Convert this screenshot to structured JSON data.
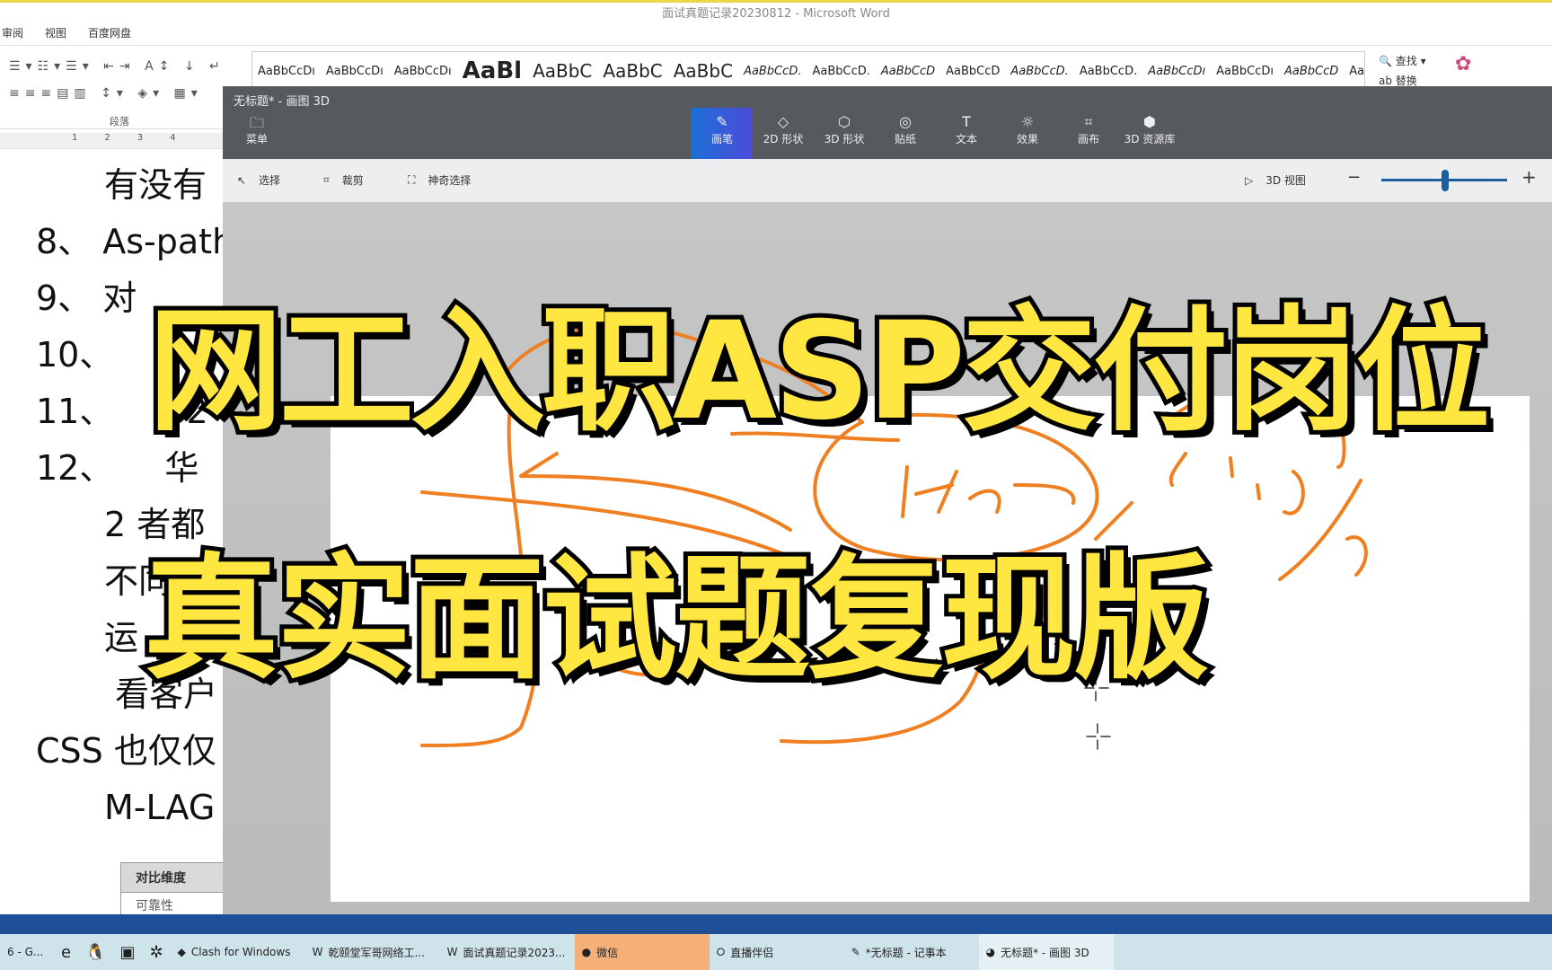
{
  "word": {
    "title": "面试真题记录20230812 - Microsoft Word",
    "tabs": [
      "审阅",
      "视图",
      "百度网盘"
    ],
    "paragraph_group": "段落",
    "styles": [
      "AaBbCcDı",
      "AaBbCcDı",
      "AaBbCcDı",
      "AaBl",
      "AaBbC",
      "AaBbC",
      "AaBbC",
      "AaBbCcD.",
      "AaBbCcD.",
      "AaBbCcD",
      "AaBbCcD",
      "AaBbCcD.",
      "AaBbCcD.",
      "AaBbCcDı",
      "AaBbCcDı",
      "AaBbCcD",
      "AaBbCcDı"
    ],
    "find": "查找",
    "replace": "替换",
    "ruler": [
      "1",
      "2",
      "3",
      "4"
    ],
    "doc_lines": [
      "　　有没有",
      "8、 As-path",
      "9、 对",
      "10、",
      "11、　　S2",
      "12、　　华",
      "　　2 者都",
      "　　不同",
      "　　运",
      "　　 看客户",
      "CSS 也仅仅",
      "　　M-LAG"
    ],
    "table": {
      "header": "对比维度",
      "cell": "可靠性"
    }
  },
  "paint3d": {
    "title": "无标题* - 画图 3D",
    "menu": "菜单",
    "tools": [
      {
        "label": "画笔",
        "icon": "brush-icon",
        "active": true
      },
      {
        "label": "2D 形状",
        "icon": "2d-shapes-icon"
      },
      {
        "label": "3D 形状",
        "icon": "3d-shapes-icon"
      },
      {
        "label": "贴纸",
        "icon": "sticker-icon"
      },
      {
        "label": "文本",
        "icon": "text-icon"
      },
      {
        "label": "效果",
        "icon": "effects-icon"
      },
      {
        "label": "画布",
        "icon": "canvas-icon"
      },
      {
        "label": "3D 资源库",
        "icon": "3d-library-icon"
      }
    ],
    "subtools": [
      "选择",
      "裁剪",
      "神奇选择"
    ],
    "view3d": "3D 视图",
    "zoom_percent": 50,
    "accent": "#1e6fd6",
    "stroke_color": "#f07f22"
  },
  "overlay": {
    "line1": "网工入职ASP交付岗位",
    "line2": "真实面试题复现版",
    "color": "#ffe640"
  },
  "taskbar": {
    "items": [
      "6 - G...",
      "Clash for Windows",
      "乾颐堂军哥网络工...",
      "面试真题记录2023...",
      "微信",
      "直播伴侣",
      "*无标题 - 记事本",
      "无标题* - 画图 3D"
    ]
  }
}
